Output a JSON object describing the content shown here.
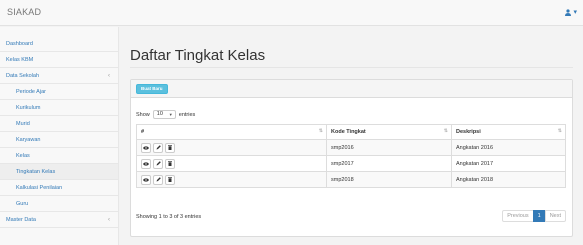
{
  "app": {
    "brand": "SIAKAD",
    "user_caret": "▾"
  },
  "sidebar": {
    "items": [
      {
        "label": "Dashboard"
      },
      {
        "label": "Kelas KBM"
      },
      {
        "label": "Data Sekolah",
        "arrow": "‹"
      },
      {
        "label": "Periode Ajar"
      },
      {
        "label": "Kurikulum"
      },
      {
        "label": "Murid"
      },
      {
        "label": "Karyawan"
      },
      {
        "label": "Kelas"
      },
      {
        "label": "Tingkatan Kelas"
      },
      {
        "label": "Kalkulasi Penilaian"
      },
      {
        "label": "Guru"
      },
      {
        "label": "Master Data",
        "arrow": "‹"
      }
    ]
  },
  "main": {
    "title": "Daftar Tingkat Kelas",
    "new_button": "Buat Baru",
    "show_label": "Show",
    "page_length": "10",
    "entries_label": "entries",
    "columns": [
      "#",
      "Kode Tingkat",
      "Deskripsi"
    ],
    "rows": [
      {
        "kode": "smp2016",
        "deskripsi": "Angkatan 2016"
      },
      {
        "kode": "smp2017",
        "deskripsi": "Angkatan 2017"
      },
      {
        "kode": "smp2018",
        "deskripsi": "Angkatan 2018"
      }
    ],
    "info": "Showing 1 to 3 of 3 entries",
    "pagination": {
      "previous": "Previous",
      "current": "1",
      "next": "Next"
    }
  },
  "colors": {
    "link": "#337ab7",
    "info_button": "#5bc0de",
    "active_page": "#337ab7"
  }
}
